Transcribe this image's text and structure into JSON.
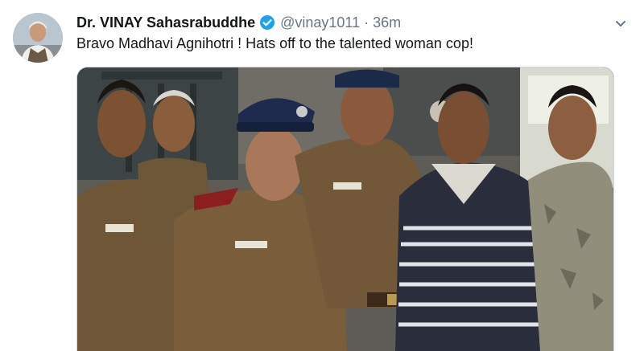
{
  "tweet": {
    "display_name": "Dr. VINAY Sahasrabuddhe",
    "handle": "@vinay1011",
    "separator": "·",
    "time": "36m",
    "text": "Bravo Madhavi Agnihotri ! Hats off to the talented woman cop!"
  },
  "icons": {
    "verified": "verified-badge-icon",
    "menu": "chevron-down-icon"
  },
  "colors": {
    "name": "#14171a",
    "secondary": "#657786",
    "verified": "#1da1f2",
    "border": "#ccd6dd"
  }
}
